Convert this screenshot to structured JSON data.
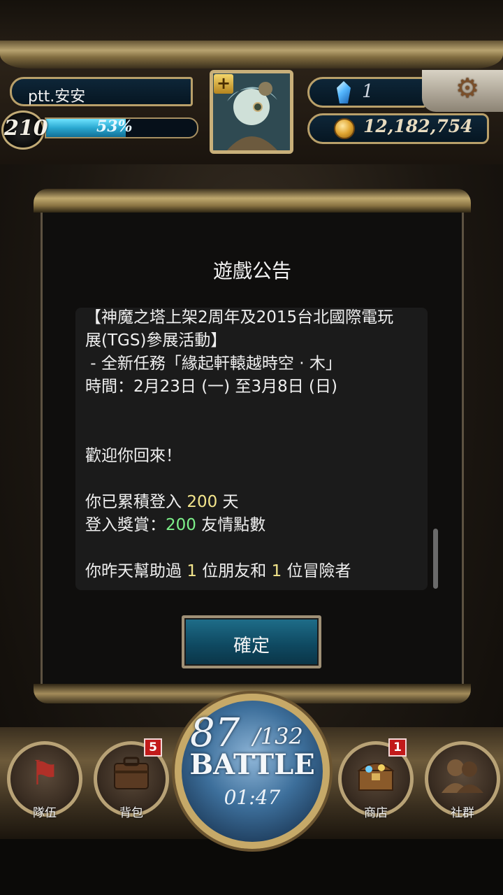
{
  "player": {
    "name": "ptt.安安",
    "level": "210",
    "exp_percent": 53,
    "exp_text": "53%"
  },
  "currency": {
    "gems": "1",
    "coins": "12,182,754"
  },
  "dialog": {
    "title": "遊戲公告",
    "notice_title_line1": "【神魔之塔上架2周年及2015台北國際電玩",
    "notice_title_line2": "展(TGS)參展活動】",
    "notice_mission": " - 全新任務「緣起軒轅越時空 · 木」",
    "notice_time": "時間：2月23日 (一) 至3月8日 (日)",
    "welcome": "歡迎你回來！",
    "login_prefix": "你已累積登入 ",
    "login_days": "200",
    "login_suffix": " 天",
    "reward_prefix": "登入獎賞：",
    "reward_points": "200",
    "reward_suffix": " 友情點數",
    "helped_prefix": "你昨天幫助過 ",
    "helped_friends": "1",
    "helped_mid": " 位朋友和 ",
    "helped_adventurers": "1",
    "helped_suffix": " 位冒險者",
    "confirm_label": "確定"
  },
  "nav": {
    "team_label": "隊伍",
    "backpack_label": "背包",
    "backpack_badge": "5",
    "shop_label": "商店",
    "shop_badge": "1",
    "social_label": "社群",
    "battle": {
      "stamina_current": "87",
      "stamina_max": "/132",
      "label": "BATTLE",
      "timer": "01:47"
    }
  },
  "icons": {
    "team": "flag-icon",
    "backpack": "bag-icon",
    "shop": "chest-icon",
    "social": "people-icon",
    "settings": "gear-icon",
    "gem": "diamond-icon",
    "coin": "coin-icon"
  }
}
